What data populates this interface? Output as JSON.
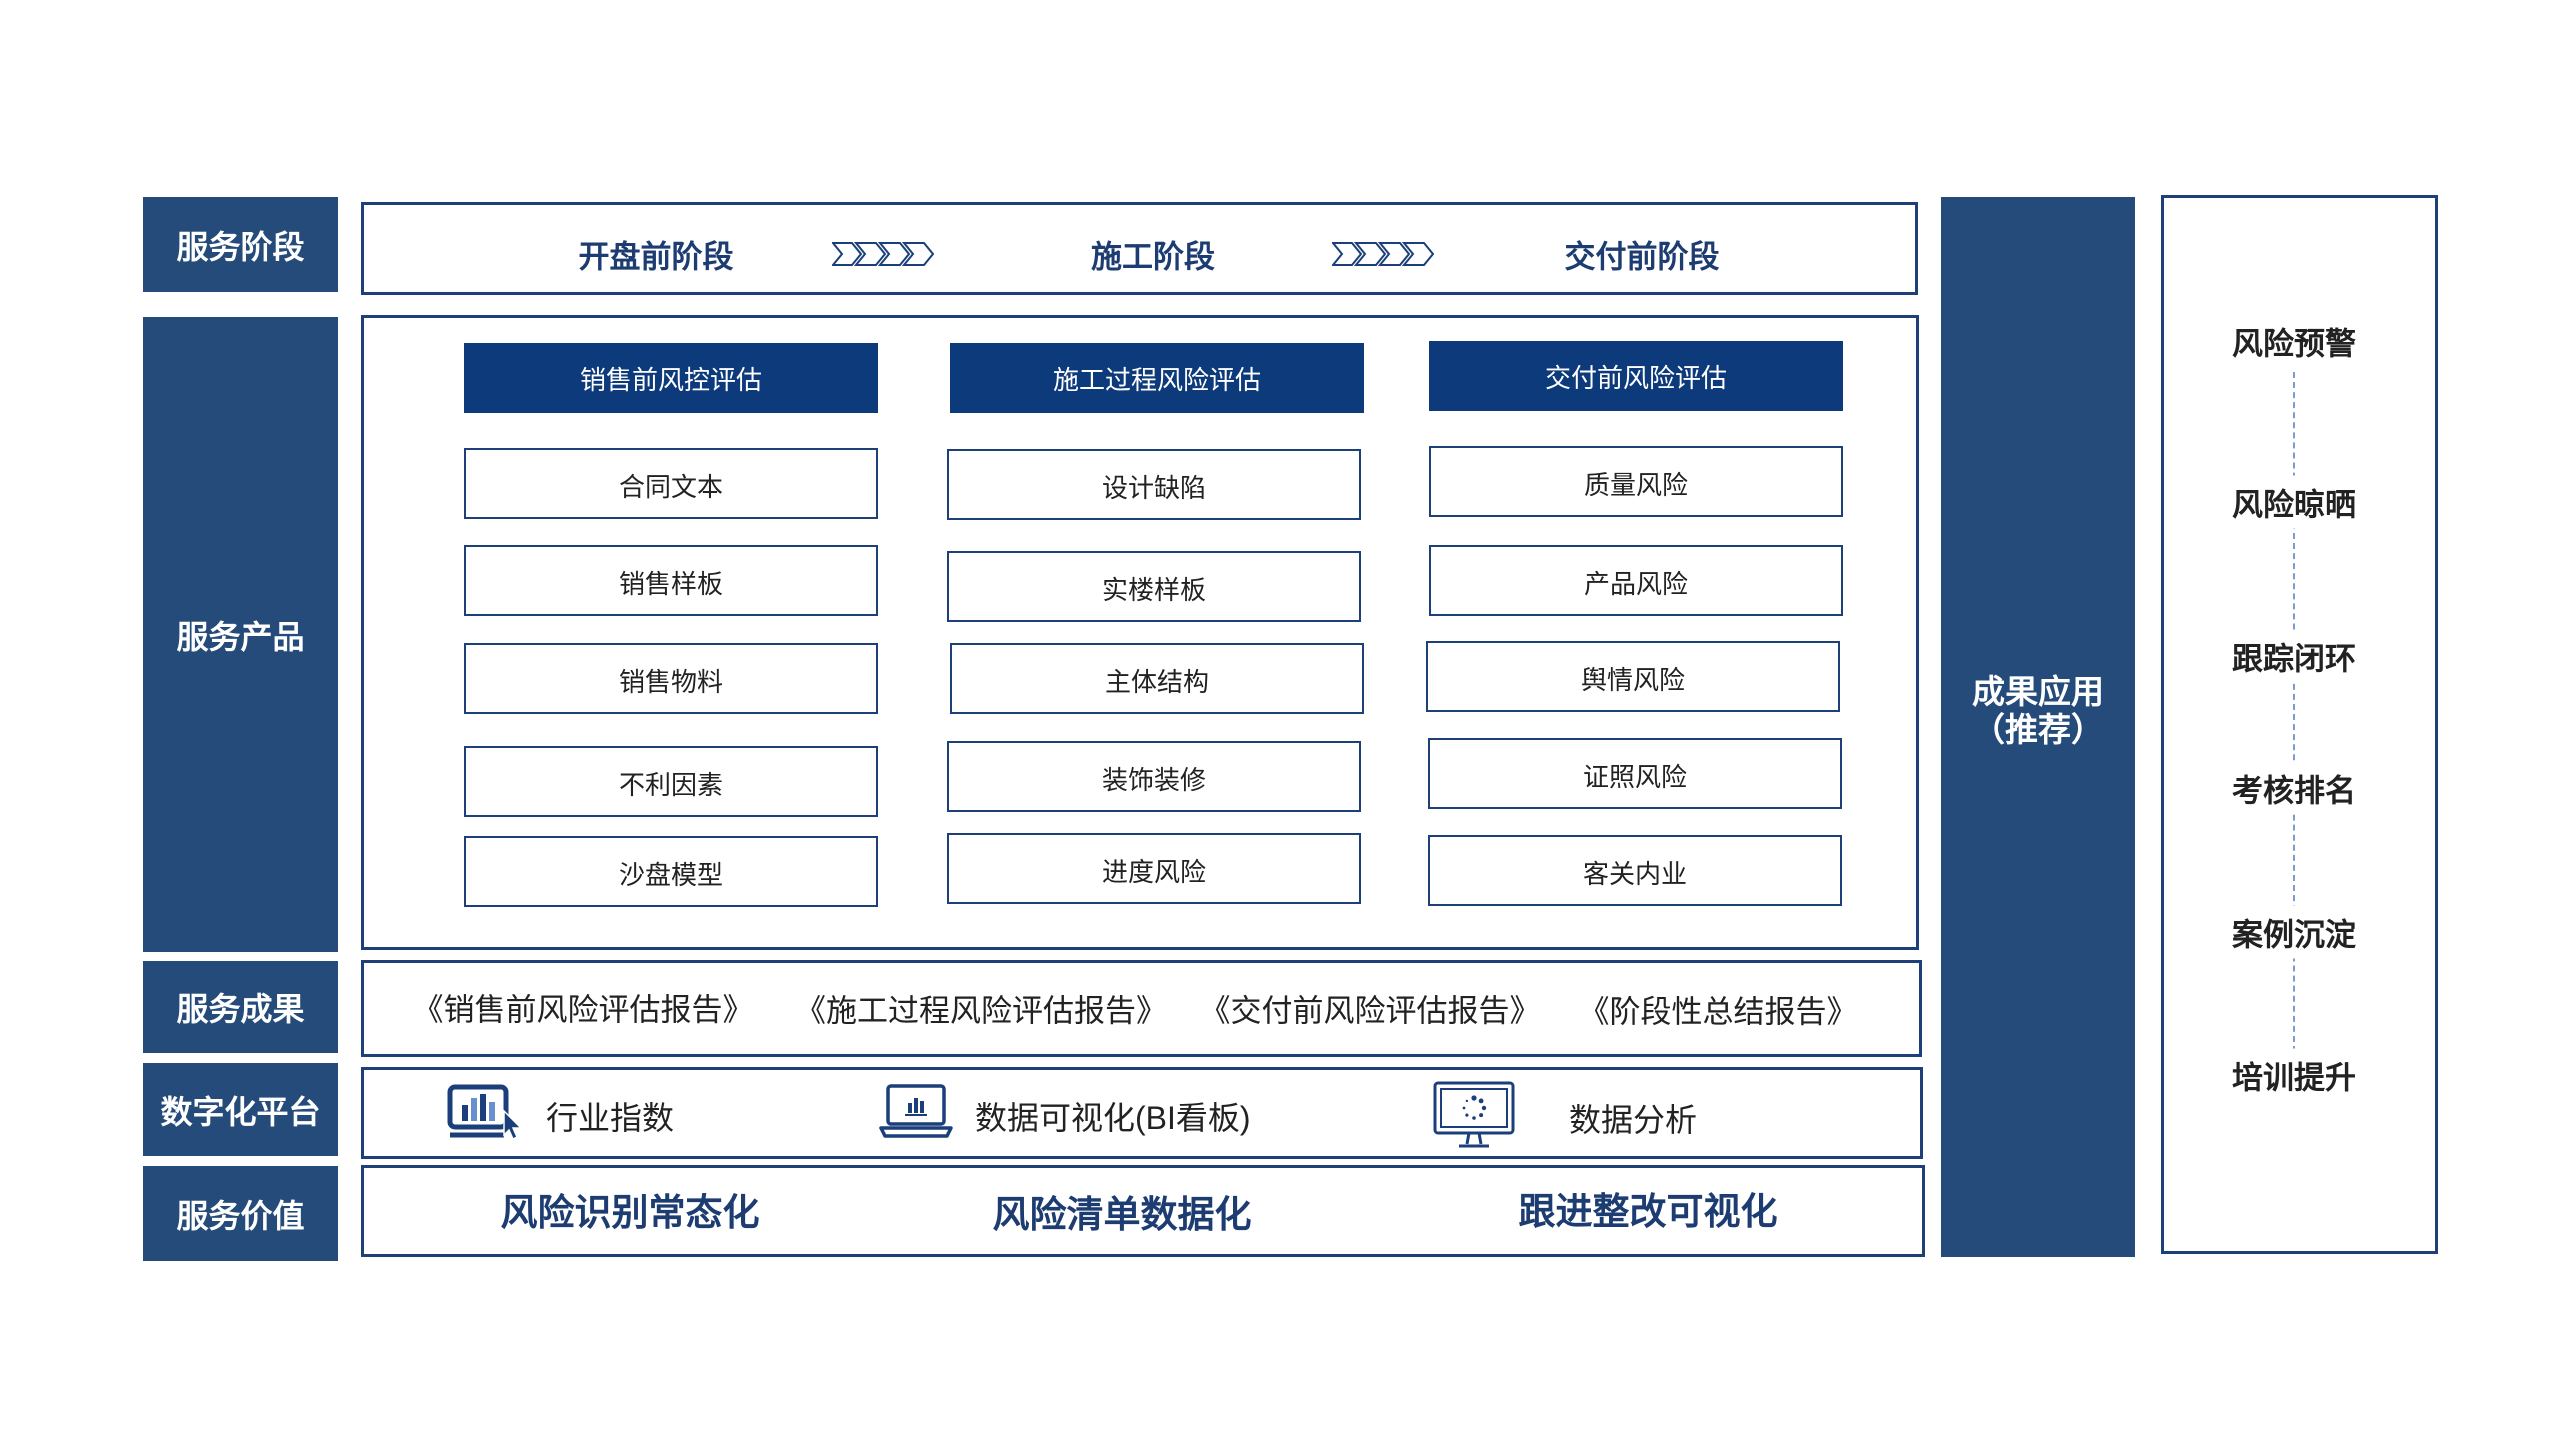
{
  "colors": {
    "navy_block": "#244b7a",
    "header_fill": "#0c3a7b",
    "border": "#1e4079",
    "text_navy": "#1d3c72"
  },
  "rows": {
    "stage_label": "服务阶段",
    "product_label": "服务产品",
    "result_label": "服务成果",
    "platform_label": "数字化平台",
    "value_label": "服务价值"
  },
  "stages": [
    {
      "label": "开盘前阶段"
    },
    {
      "label": "施工阶段"
    },
    {
      "label": "交付前阶段"
    }
  ],
  "stage_arrow_icon": "chevrons-right-icon",
  "products": [
    {
      "header": "销售前风控评估",
      "items": [
        "合同文本",
        "销售样板",
        "销售物料",
        "不利因素",
        "沙盘模型"
      ]
    },
    {
      "header": "施工过程风险评估",
      "items": [
        "设计缺陷",
        "实楼样板",
        "主体结构",
        "装饰装修",
        "进度风险"
      ]
    },
    {
      "header": "交付前风险评估",
      "items": [
        "质量风险",
        "产品风险",
        "舆情风险",
        "证照风险",
        "客关内业"
      ]
    }
  ],
  "results": [
    "《销售前风险评估报告》",
    "《施工过程风险评估报告》",
    "《交付前风险评估报告》",
    "《阶段性总结报告》"
  ],
  "platform": [
    {
      "icon": "screen-chart-icon",
      "label": "行业指数"
    },
    {
      "icon": "laptop-chart-icon",
      "label": "数据可视化(BI看板)"
    },
    {
      "icon": "monitor-loading-icon",
      "label": "数据分析"
    }
  ],
  "values": [
    "风险识别常态化",
    "风险清单数据化",
    "跟进整改可视化"
  ],
  "application": {
    "title": "成果应用",
    "subtitle": "（推荐）",
    "items": [
      "风险预警",
      "风险晾晒",
      "跟踪闭环",
      "考核排名",
      "案例沉淀",
      "培训提升"
    ]
  }
}
